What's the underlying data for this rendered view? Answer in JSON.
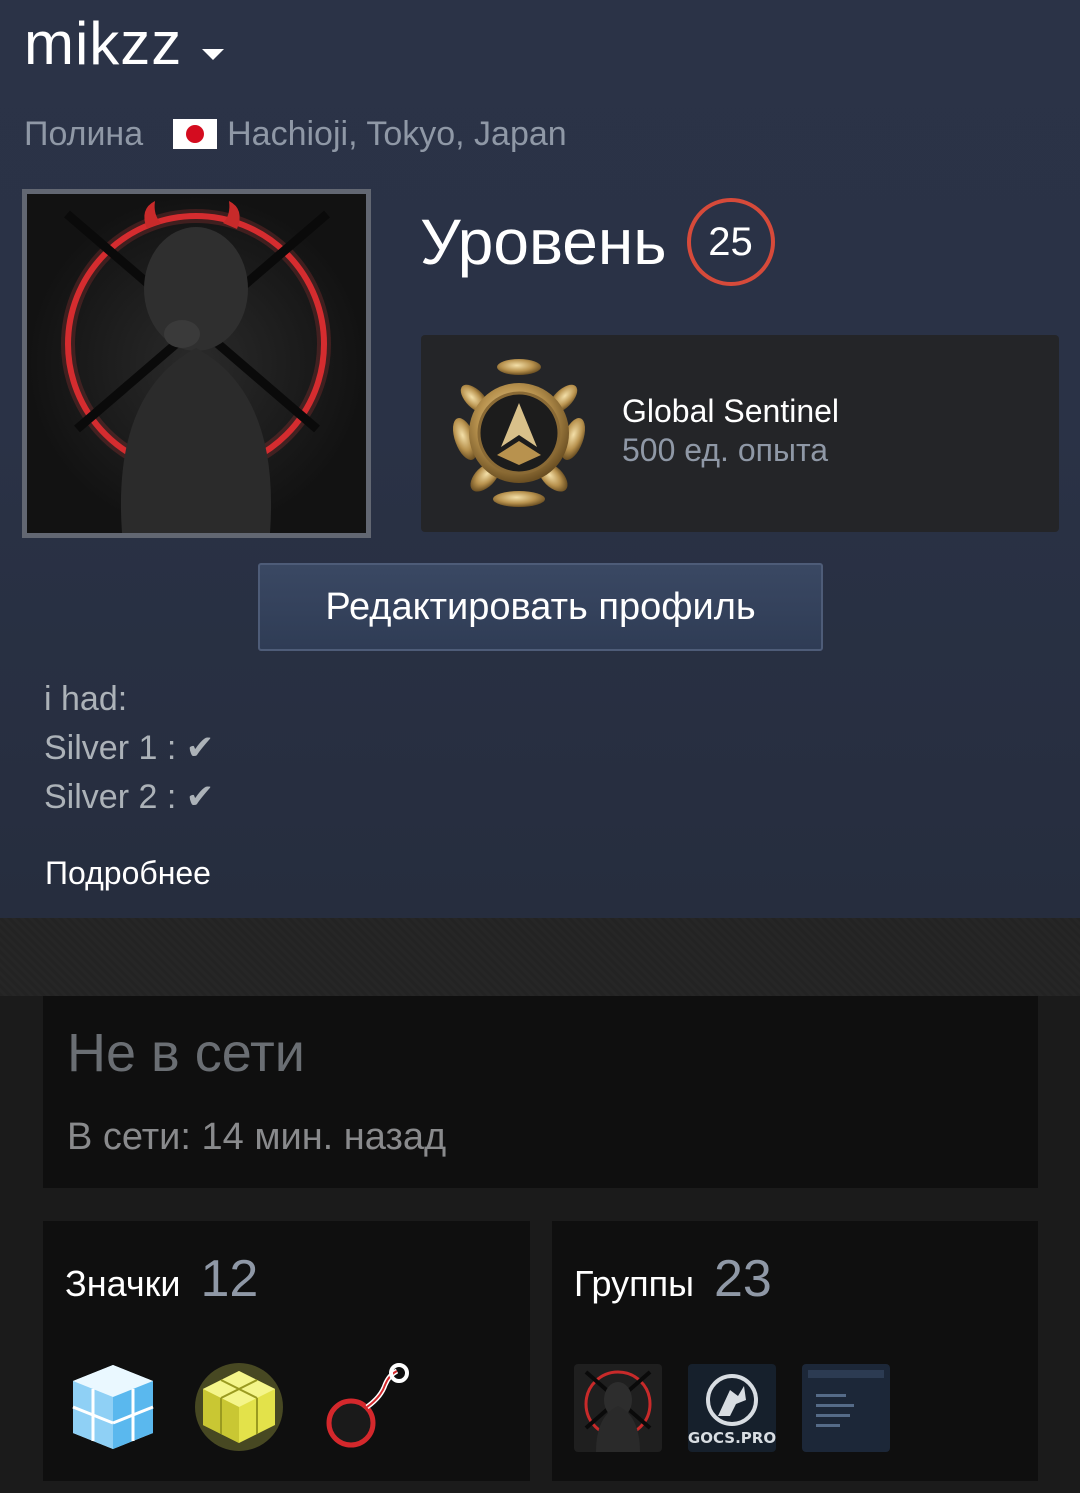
{
  "profile": {
    "username": "mikzz",
    "real_name": "Полина",
    "location": "Hachioji, Tokyo, Japan"
  },
  "level": {
    "label": "Уровень",
    "value": "25"
  },
  "featured_badge": {
    "name": "Global Sentinel",
    "xp": "500 ед. опыта"
  },
  "edit_button": "Редактировать профиль",
  "summary": {
    "line1": "i had:",
    "line2": "Silver 1 : ✔",
    "line3": "Silver 2 : ✔",
    "more": "Подробнее"
  },
  "status": {
    "title": "Не в сети",
    "last_online": "В сети: 14 мин. назад"
  },
  "badges_panel": {
    "title": "Значки",
    "count": "12"
  },
  "groups_panel": {
    "title": "Группы",
    "count": "23"
  },
  "colors": {
    "level_ring": "#d64a3a",
    "hero_bg": "#2a3246",
    "accent_button": "#34425c"
  },
  "icons": [
    "caret-down-icon",
    "japan-flag-icon",
    "medal-icon",
    "check-icon"
  ]
}
